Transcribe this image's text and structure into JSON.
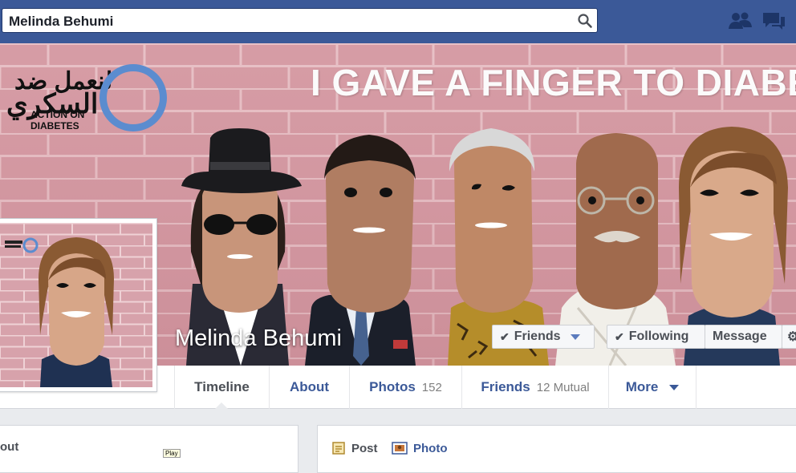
{
  "search": {
    "value": "Melinda Behumi"
  },
  "topbar": {
    "icons": [
      "friend-requests-icon",
      "messages-icon"
    ]
  },
  "cover": {
    "headline": "I GAVE A FINGER TO DIABETES.",
    "logo_arabic_line1": "لنعمل ضد",
    "logo_arabic_line2": "السكري",
    "logo_english_line1": "ACTION ON",
    "logo_english_line2": "DIABETES",
    "profile_name": "Melinda Behumi",
    "buttons": {
      "friends": "Friends",
      "following": "Following",
      "message": "Message"
    },
    "colors": {
      "logo_ring": "#5b8ccf",
      "brand_blue": "#3b5998"
    }
  },
  "tabs": [
    {
      "label": "Timeline",
      "count": ""
    },
    {
      "label": "About",
      "count": ""
    },
    {
      "label": "Photos",
      "count": "152"
    },
    {
      "label": "Friends",
      "count": "12 Mutual"
    },
    {
      "label": "More",
      "count": ""
    }
  ],
  "left_panel": {
    "text": "out"
  },
  "composer": {
    "post_label": "Post",
    "photo_label": "Photo"
  },
  "tooltip": {
    "text": "Play"
  }
}
